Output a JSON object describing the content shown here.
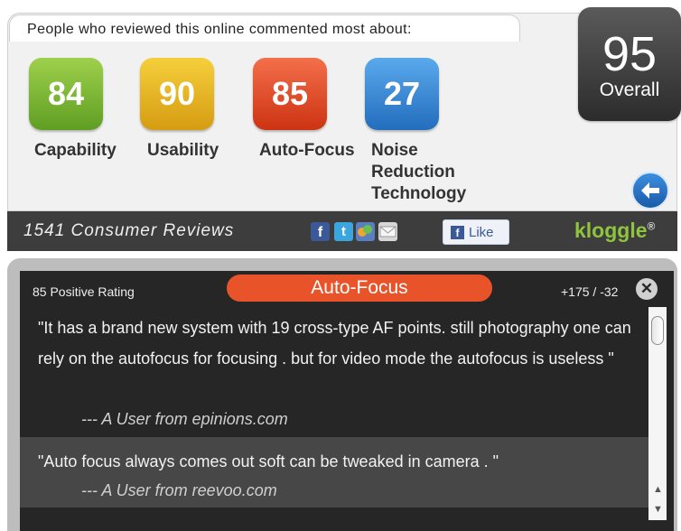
{
  "header": {
    "text": "People who reviewed this online commented most about:"
  },
  "overall": {
    "score": "95",
    "label": "Overall"
  },
  "categories": [
    {
      "score": "84",
      "label": "Capability",
      "color": "#7cbf35"
    },
    {
      "score": "90",
      "label": "Usability",
      "color": "#e8b828"
    },
    {
      "score": "85",
      "label": "Auto-Focus",
      "color": "#e24e2a"
    },
    {
      "score": "27",
      "label": "Noise Reduction Technology",
      "color": "#3f8ad8"
    }
  ],
  "bar": {
    "reviews_count": "1541 Consumer Reviews",
    "social_icons": [
      "facebook-icon",
      "twitter-icon",
      "messenger-icon",
      "mail-icon"
    ],
    "like_label": "Like",
    "logo": "kloggle",
    "logo_mark": "®"
  },
  "detail": {
    "rating_text": "85 Positive Rating",
    "topic": "Auto-Focus",
    "ratio": "+175 / -32",
    "reviews": [
      {
        "text": "\"It has a brand new system with 19 cross-type AF points. still photography one can rely on the autofocus for focusing . but for video mode the autofocus is useless \"",
        "author": "--- A User from epinions.com"
      },
      {
        "text": "\"Auto focus always comes out soft can be tweaked in camera . \"",
        "author": "--- A User from reevoo.com"
      }
    ]
  }
}
